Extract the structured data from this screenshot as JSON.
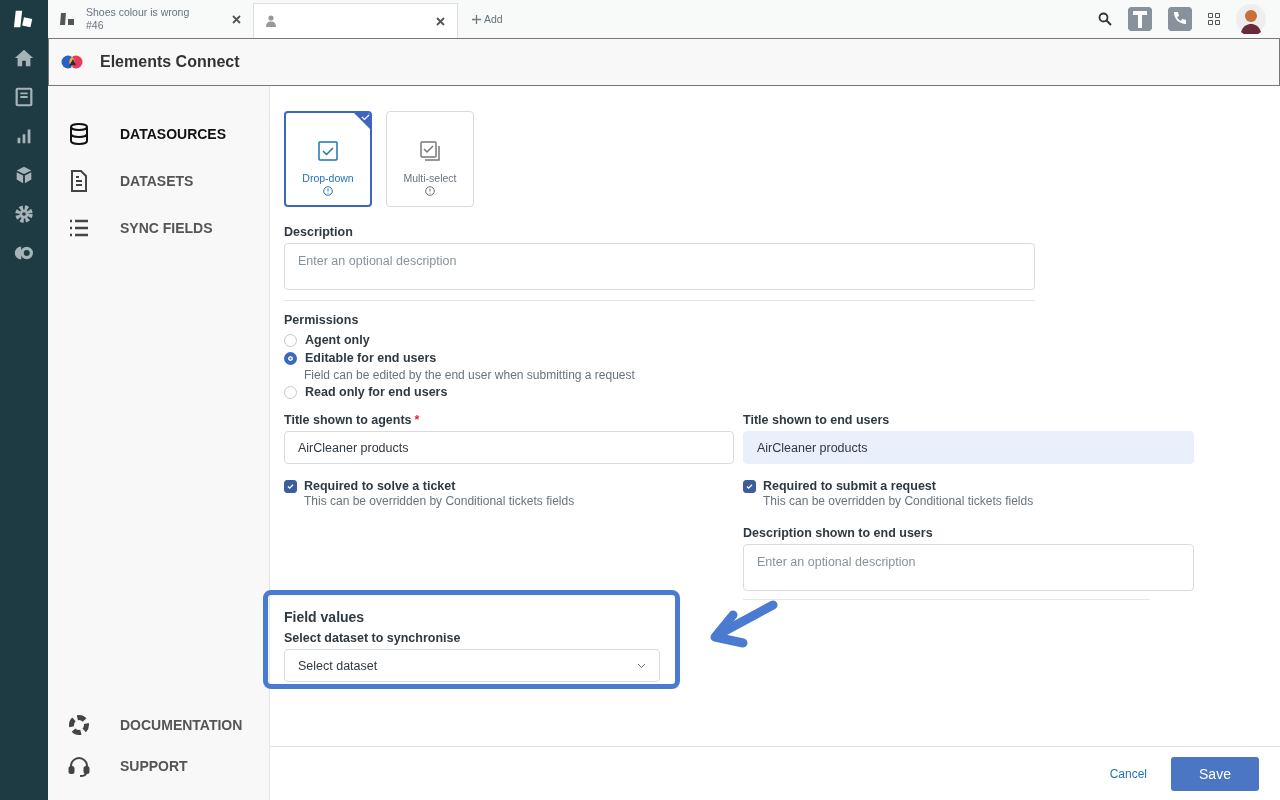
{
  "tabs": [
    {
      "kind": "ticket",
      "title": "Shoes colour is wrong",
      "subtitle": "#46",
      "selected": false
    },
    {
      "kind": "user",
      "selected": true
    }
  ],
  "add_tab": "Add",
  "app": {
    "title": "Elements Connect"
  },
  "sidebar": {
    "items": [
      {
        "label": "DATASOURCES",
        "selected": true
      },
      {
        "label": "DATASETS",
        "selected": false
      },
      {
        "label": "SYNC FIELDS",
        "selected": false
      }
    ],
    "footer_items": [
      {
        "label": "DOCUMENTATION"
      },
      {
        "label": "SUPPORT"
      }
    ]
  },
  "field_types": [
    {
      "label": "Drop-down",
      "selected": true
    },
    {
      "label": "Multi-select",
      "selected": false
    }
  ],
  "description": {
    "label": "Description",
    "placeholder": "Enter an optional description"
  },
  "permissions": {
    "label": "Permissions",
    "options": [
      {
        "label": "Agent only",
        "selected": false
      },
      {
        "label": "Editable for end users",
        "hint": "Field can be edited by the end user when submitting a request",
        "selected": true
      },
      {
        "label": "Read only for end users",
        "selected": false
      }
    ]
  },
  "title_agents": {
    "label": "Title shown to agents",
    "required_mark": "*",
    "value": "AirCleaner products"
  },
  "title_end_users": {
    "label": "Title shown to end users",
    "value": "AirCleaner products"
  },
  "checkboxes": [
    {
      "label": "Required to solve a ticket",
      "hint": "This can be overridden by Conditional tickets fields",
      "checked": true
    },
    {
      "label": "Required to submit a request",
      "hint": "This can be overridden by Conditional tickets fields",
      "checked": true
    }
  ],
  "end_user_description": {
    "label": "Description shown to end users",
    "placeholder": "Enter an optional description"
  },
  "field_values": {
    "title": "Field values",
    "label": "Select dataset to synchronise",
    "placeholder": "Select dataset"
  },
  "footer": {
    "cancel": "Cancel",
    "save": "Save"
  }
}
